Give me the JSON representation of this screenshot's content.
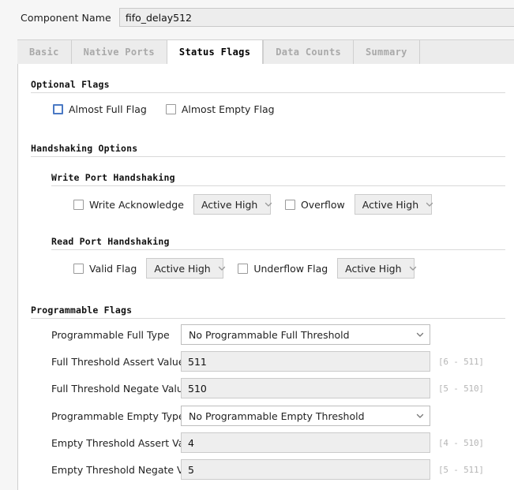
{
  "component": {
    "label": "Component Name",
    "value": "fifo_delay512"
  },
  "tabs": [
    {
      "label": "Basic",
      "active": false
    },
    {
      "label": "Native Ports",
      "active": false
    },
    {
      "label": "Status Flags",
      "active": true
    },
    {
      "label": "Data Counts",
      "active": false
    },
    {
      "label": "Summary",
      "active": false
    }
  ],
  "optional_flags": {
    "title": "Optional Flags",
    "almost_full": {
      "label": "Almost Full Flag",
      "checked": false,
      "focused": true
    },
    "almost_empty": {
      "label": "Almost Empty Flag",
      "checked": false,
      "focused": false
    }
  },
  "handshaking": {
    "title": "Handshaking Options",
    "write_port": {
      "title": "Write Port Handshaking",
      "write_ack": {
        "label": "Write Acknowledge",
        "checked": false,
        "polarity": "Active High"
      },
      "overflow": {
        "label": "Overflow",
        "checked": false,
        "polarity": "Active High"
      }
    },
    "read_port": {
      "title": "Read Port Handshaking",
      "valid_flag": {
        "label": "Valid Flag",
        "checked": false,
        "polarity": "Active High"
      },
      "underflow_flag": {
        "label": "Underflow Flag",
        "checked": false,
        "polarity": "Active High"
      }
    }
  },
  "programmable_flags": {
    "title": "Programmable Flags",
    "full_type": {
      "label": "Programmable Full Type",
      "value": "No Programmable Full Threshold"
    },
    "full_assert": {
      "label": "Full Threshold Assert Value",
      "value": "511",
      "range": "[6 - 511]"
    },
    "full_negate": {
      "label": "Full Threshold Negate Value",
      "value": "510",
      "range": "[5 - 510]"
    },
    "empty_type": {
      "label": "Programmable Empty Type",
      "value": "No Programmable Empty Threshold"
    },
    "empty_assert": {
      "label": "Empty Threshold Assert Value",
      "value": "4",
      "range": "[4 - 510]"
    },
    "empty_negate": {
      "label": "Empty Threshold Negate Value",
      "value": "5",
      "range": "[5 - 511]"
    }
  },
  "icons": {
    "chevron_down": "chevron-down-icon"
  },
  "colors": {
    "focus_border": "#4a79c4",
    "panel_bg": "#ffffff",
    "field_bg": "#eeeeee",
    "window_bg": "#f6f6f6"
  }
}
